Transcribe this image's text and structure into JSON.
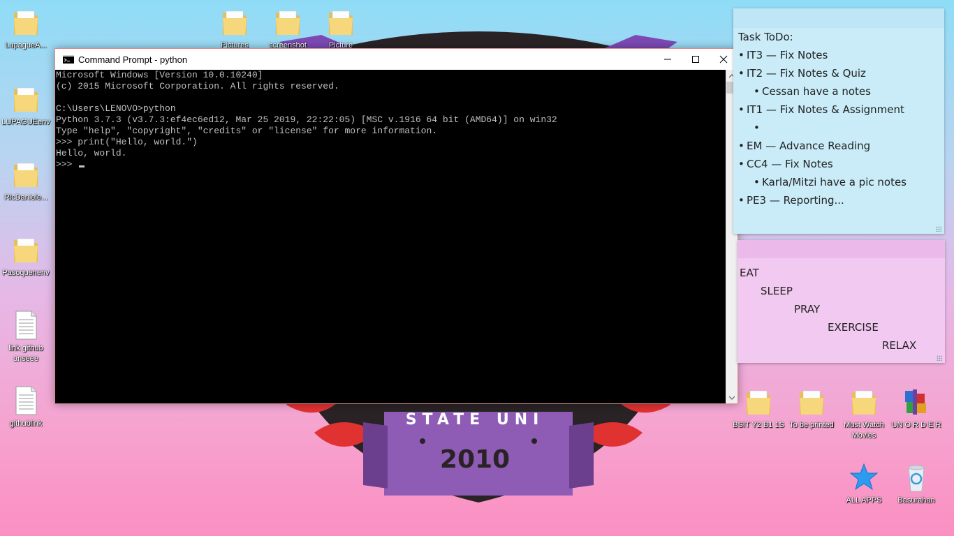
{
  "desktop": {
    "left_icons": [
      {
        "label": "LupagueA...",
        "icon": "folder-icon"
      },
      {
        "label": "LUPAGUEenv",
        "icon": "folder-icon"
      },
      {
        "label": "RicDaniele...",
        "icon": "folder-icon"
      },
      {
        "label": "Pasoquenenv",
        "icon": "folder-icon"
      },
      {
        "label": "link github anseee",
        "icon": "text-file-icon"
      },
      {
        "label": "githublink",
        "icon": "text-file-icon"
      }
    ],
    "top_icons": [
      {
        "label": "Pictures",
        "icon": "folder-icon"
      },
      {
        "label": "screenshot",
        "icon": "folder-icon"
      },
      {
        "label": "Picture",
        "icon": "folder-icon"
      }
    ],
    "right_icons": [
      {
        "label": "BSIT Y2 B1 1S",
        "icon": "folder-icon"
      },
      {
        "label": "To be printed",
        "icon": "folder-icon"
      },
      {
        "label": "Must Watch Movies",
        "icon": "folder-icon"
      },
      {
        "label": "UN O R D E R",
        "icon": "winrar-icon"
      },
      {
        "label": "ALL APPS",
        "icon": "star-icon"
      },
      {
        "label": "Basurahan",
        "icon": "recycle-bin-icon"
      }
    ],
    "wallpaper": {
      "text": "STATE UNI",
      "year": "2010"
    }
  },
  "cmd": {
    "title": "Command Prompt - python",
    "lines": [
      "Microsoft Windows [Version 10.0.10240]",
      "(c) 2015 Microsoft Corporation. All rights reserved.",
      "",
      "C:\\Users\\LENOVO>python",
      "Python 3.7.3 (v3.7.3:ef4ec6ed12, Mar 25 2019, 22:22:05) [MSC v.1916 64 bit (AMD64)] on win32",
      "Type \"help\", \"copyright\", \"credits\" or \"license\" for more information.",
      ">>> print(\"Hello, world.\")",
      "Hello, world."
    ],
    "prompt": ">>> "
  },
  "sticky_todo": {
    "title": "Task ToDo:",
    "items": [
      {
        "text": "IT3 — Fix Notes",
        "level": 0
      },
      {
        "text": "IT2 — Fix Notes & Quiz",
        "level": 0
      },
      {
        "text": "Cessan have a notes",
        "level": 1
      },
      {
        "text": "IT1 — Fix Notes & Assignment",
        "level": 0
      },
      {
        "text": "",
        "level": 1
      },
      {
        "text": "EM — Advance Reading",
        "level": 0
      },
      {
        "text": "CC4 — Fix Notes",
        "level": 0
      },
      {
        "text": "Karla/Mitzi have a pic notes",
        "level": 1
      },
      {
        "text": "PE3 — Reporting...",
        "level": 0
      }
    ]
  },
  "sticky_pink": {
    "words": [
      "EAT",
      "SLEEP",
      "PRAY",
      "EXERCISE",
      "RELAX"
    ]
  }
}
